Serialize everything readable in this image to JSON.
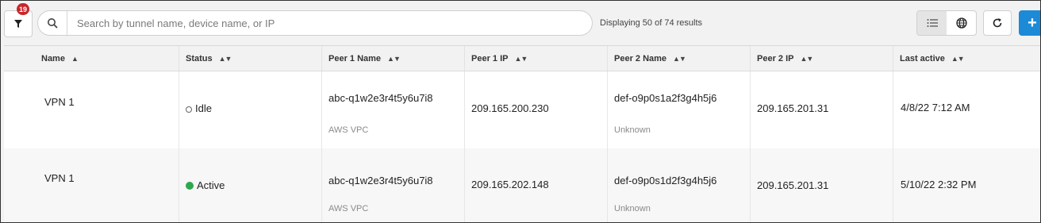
{
  "toolbar": {
    "filter_count": "19",
    "search_placeholder": "Search by tunnel name, device name, or IP",
    "search_value": "",
    "results_text": "Displaying 50 of 74 results",
    "add_label": "+"
  },
  "table": {
    "columns": [
      {
        "label": "Name",
        "sort": "asc"
      },
      {
        "label": "Status",
        "sort": "none"
      },
      {
        "label": "Peer 1 Name",
        "sort": "none"
      },
      {
        "label": "Peer 1 IP",
        "sort": "none"
      },
      {
        "label": "Peer 2 Name",
        "sort": "none"
      },
      {
        "label": "Peer 2 IP",
        "sort": "none"
      },
      {
        "label": "Last active",
        "sort": "none"
      }
    ],
    "rows": [
      {
        "name": "VPN 1",
        "status": "Idle",
        "peer1_name": "abc-q1w2e3r4t5y6u7i8",
        "peer1_type": "AWS VPC",
        "peer1_ip": "209.165.200.230",
        "peer2_name": "def-o9p0s1a2f3g4h5j6",
        "peer2_type": "Unknown",
        "peer2_ip": "209.165.201.31",
        "last_active": "4/8/22 7:12 AM"
      },
      {
        "name": "VPN 1",
        "status": "Active",
        "peer1_name": "abc-q1w2e3r4t5y6u7i8",
        "peer1_type": "AWS VPC",
        "peer1_ip": "209.165.202.148",
        "peer2_name": "def-o9p0s1d2f3g4h5j6",
        "peer2_type": "Unknown",
        "peer2_ip": "209.165.201.31",
        "last_active": "5/10/22 2:32 PM"
      }
    ]
  },
  "colors": {
    "badge": "#c8262b",
    "accent": "#1c8ad6",
    "active": "#2fa84f"
  }
}
